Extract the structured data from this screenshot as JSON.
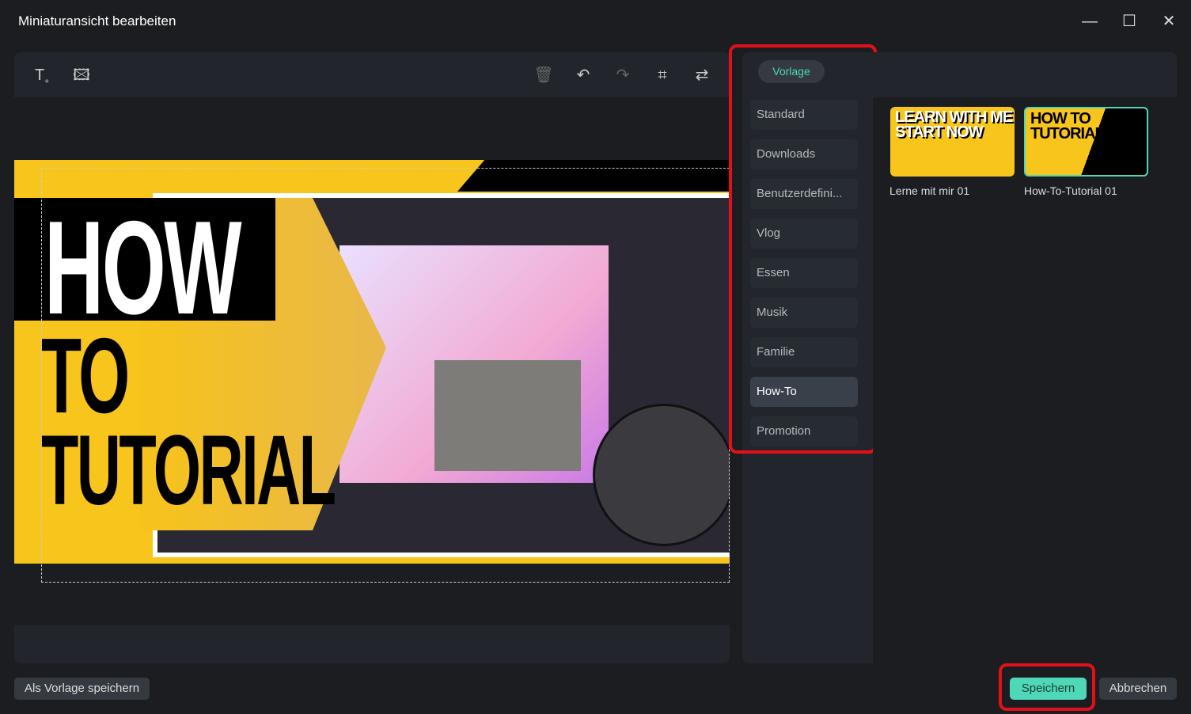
{
  "window": {
    "title": "Miniaturansicht bearbeiten",
    "minimize": "—",
    "maximize": "☐",
    "close": "✕"
  },
  "toolbar": {
    "icons": [
      "add-text-icon",
      "add-image-icon",
      "delete-icon",
      "undo-icon",
      "redo-icon",
      "crop-icon",
      "replace-icon"
    ]
  },
  "canvas": {
    "headline": [
      "HOW",
      "TO",
      "TUTORIAL"
    ]
  },
  "categories": {
    "tab": "Vorlage",
    "items": [
      "Standard",
      "Downloads",
      "Benutzerdefini...",
      "Vlog",
      "Essen",
      "Musik",
      "Familie",
      "How-To",
      "Promotion"
    ],
    "active": "How-To"
  },
  "templates": [
    {
      "name": "Lerne mit mir 01",
      "art": "LEARN WITH ME START NOW"
    },
    {
      "name": "How-To-Tutorial 01",
      "art": "HOW TO TUTORIAL",
      "selected": true
    }
  ],
  "footer": {
    "save_template": "Als Vorlage speichern",
    "save": "Speichern",
    "cancel": "Abbrechen"
  },
  "colors": {
    "accent": "#4fd8b8",
    "highlight": "#e3101a",
    "thumbnail_yellow": "#f8c51c"
  }
}
